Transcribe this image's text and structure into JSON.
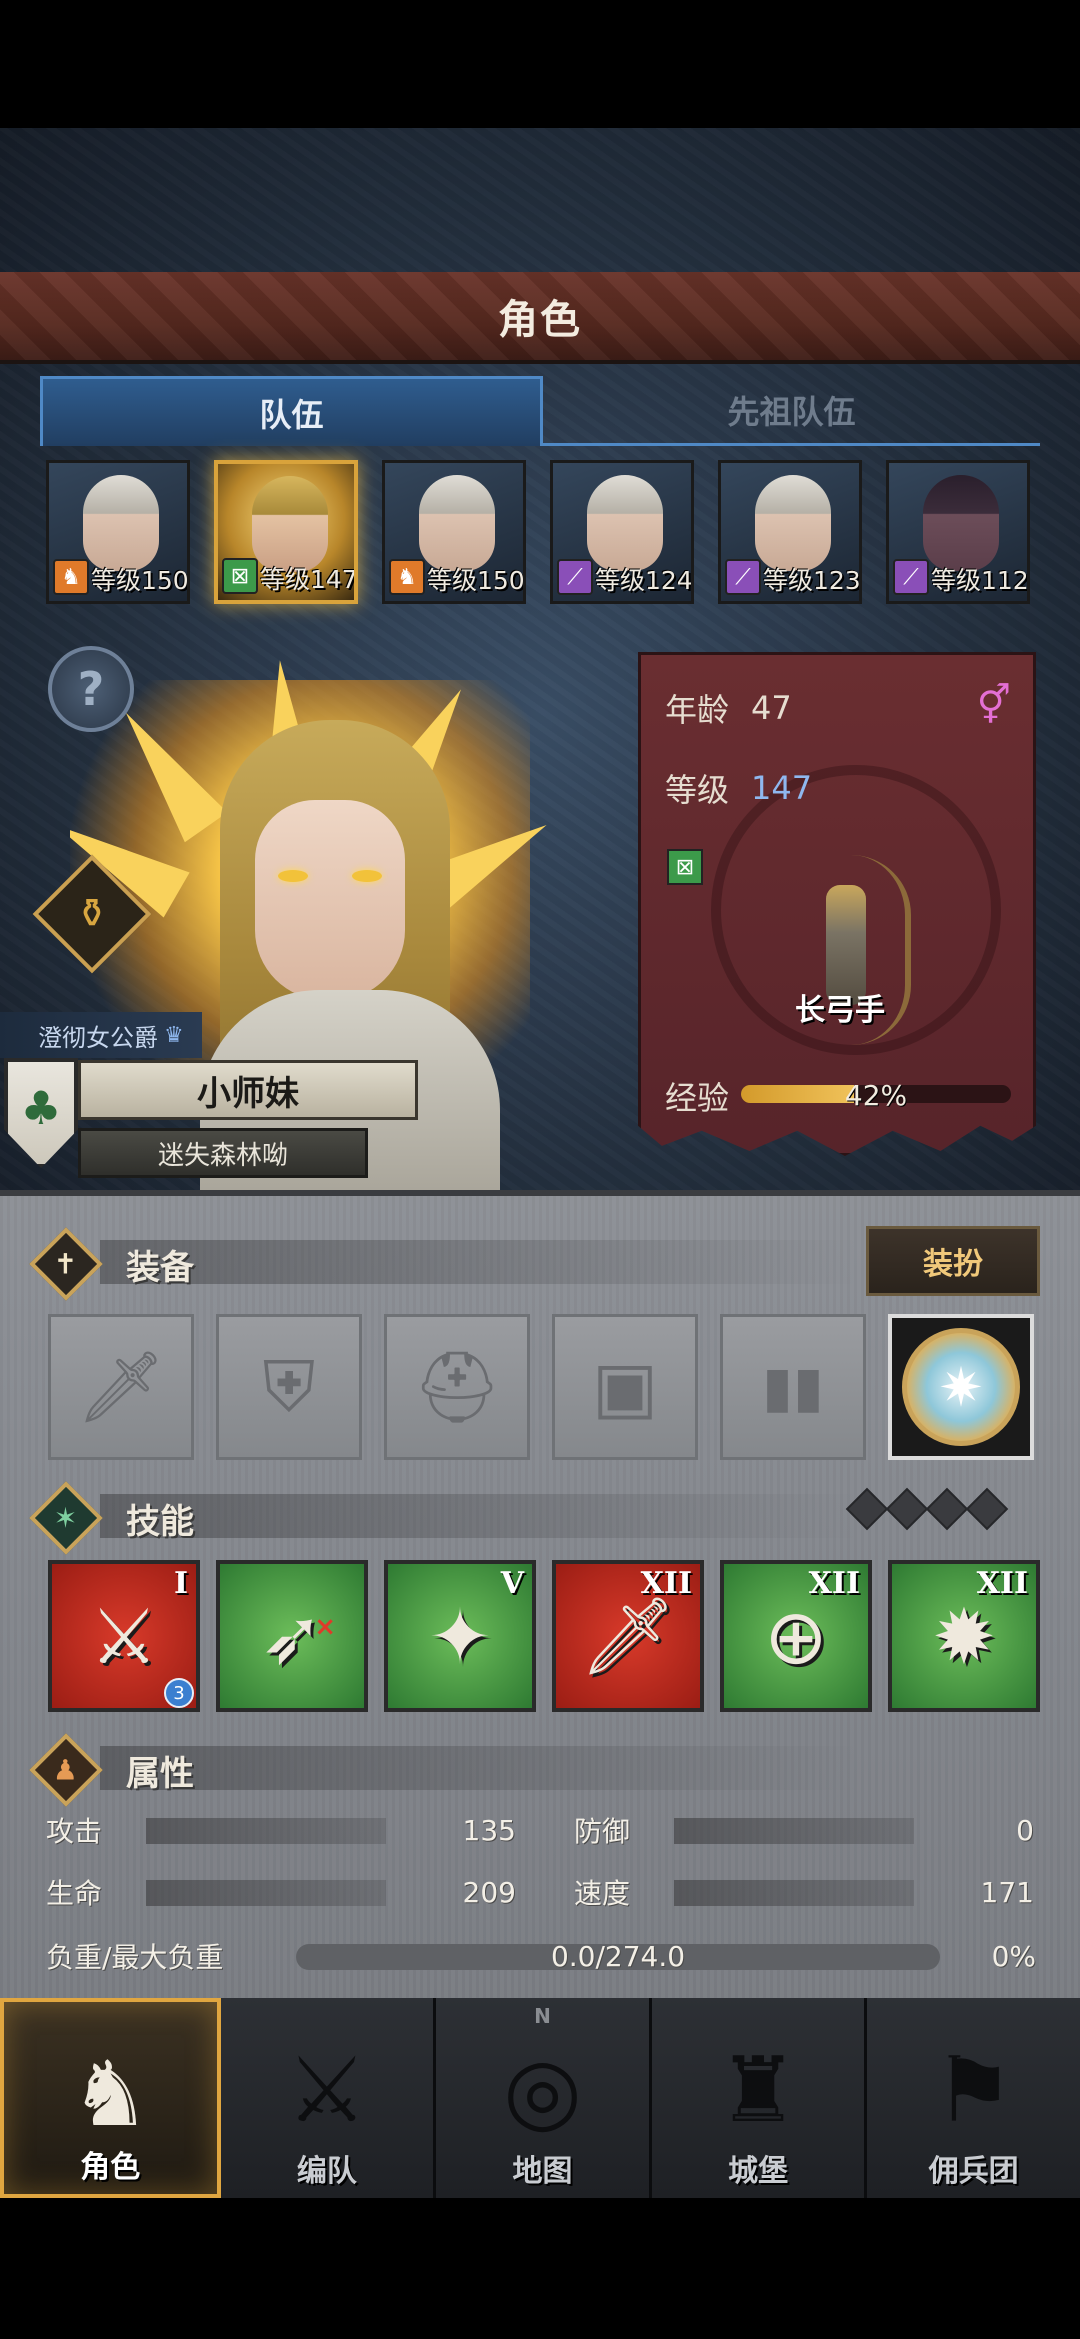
{
  "header": {
    "title": "角色"
  },
  "tabs": [
    {
      "label": "队伍",
      "active": true
    },
    {
      "label": "先祖队伍",
      "active": false
    }
  ],
  "heroes": [
    {
      "level_text": "等级150",
      "class_icon": "horse-icon",
      "hair": "white",
      "selected": false
    },
    {
      "level_text": "等级147",
      "class_icon": "bow-icon",
      "hair": "gold",
      "selected": true
    },
    {
      "level_text": "等级150",
      "class_icon": "horse-icon",
      "hair": "white",
      "selected": false
    },
    {
      "level_text": "等级124",
      "class_icon": "staff-icon",
      "hair": "white",
      "selected": false
    },
    {
      "level_text": "等级123",
      "class_icon": "staff-icon",
      "hair": "white",
      "selected": false
    },
    {
      "level_text": "等级112",
      "class_icon": "staff-icon",
      "hair": "dark",
      "selected": false
    }
  ],
  "help_icon": "question-icon",
  "potion_icon": "potion-icon",
  "character": {
    "title": "澄彻女公爵",
    "name": "小师妹",
    "subtitle": "迷失森林呦",
    "emblem_icon": "tree-icon"
  },
  "info": {
    "age_label": "年龄",
    "age": "47",
    "level_label": "等级",
    "level": "147",
    "gender_icon": "female-icon",
    "class_icon": "bow-icon",
    "class_name": "长弓手",
    "exp_label": "经验",
    "exp_percent": "42%",
    "exp_fraction": 0.42
  },
  "equipment": {
    "title": "装备",
    "dress_button": "装扮",
    "slots": [
      {
        "icon": "sword-icon",
        "glyph": "🗡",
        "filled": false
      },
      {
        "icon": "shield-icon",
        "glyph": "⛨",
        "filled": false
      },
      {
        "icon": "helmet-icon",
        "glyph": "⛑",
        "filled": false
      },
      {
        "icon": "armor-icon",
        "glyph": "▣",
        "filled": false
      },
      {
        "icon": "boots-icon",
        "glyph": "▮▮",
        "filled": false
      },
      {
        "icon": "medallion-icon",
        "glyph": "✷",
        "filled": true
      }
    ]
  },
  "skills": {
    "title": "技能",
    "items": [
      {
        "icon": "slash-skill-icon",
        "glyph": "⚔",
        "color": "red",
        "rank": "I",
        "badge": "3"
      },
      {
        "icon": "arrow-skill-icon",
        "glyph": "➶",
        "color": "green",
        "rank": "",
        "badge": ""
      },
      {
        "icon": "gem-burst-skill-icon",
        "glyph": "✦",
        "color": "green",
        "rank": "V",
        "badge": ""
      },
      {
        "icon": "blade-skill-icon",
        "glyph": "🗡",
        "color": "red",
        "rank": "XII",
        "badge": ""
      },
      {
        "icon": "target-skill-icon",
        "glyph": "⊕",
        "color": "green",
        "rank": "XII",
        "badge": ""
      },
      {
        "icon": "burst-skill-icon",
        "glyph": "✹",
        "color": "green",
        "rank": "XII",
        "badge": ""
      }
    ]
  },
  "attributes": {
    "title": "属性",
    "attack_label": "攻击",
    "attack": "135",
    "defense_label": "防御",
    "defense": "0",
    "hp_label": "生命",
    "hp": "209",
    "speed_label": "速度",
    "speed": "171",
    "load_label": "负重/最大负重",
    "load": "0.0/274.0",
    "load_percent": "0%"
  },
  "nav": {
    "items": [
      {
        "label": "角色",
        "icon": "knight-icon",
        "glyph": "♞",
        "active": true
      },
      {
        "label": "编队",
        "icon": "formation-icon",
        "glyph": "⚔",
        "active": false
      },
      {
        "label": "地图",
        "icon": "compass-map-icon",
        "glyph": "◎",
        "active": false,
        "compass": "N"
      },
      {
        "label": "城堡",
        "icon": "castle-icon",
        "glyph": "♜",
        "active": false
      },
      {
        "label": "佣兵团",
        "icon": "banner-icon",
        "glyph": "⚑",
        "active": false
      }
    ]
  },
  "colors": {
    "accent_gold": "#d9a33b",
    "tab_blue": "#4f89c6",
    "card_red": "#6a2e31",
    "level_blue": "#8fb8ef"
  }
}
